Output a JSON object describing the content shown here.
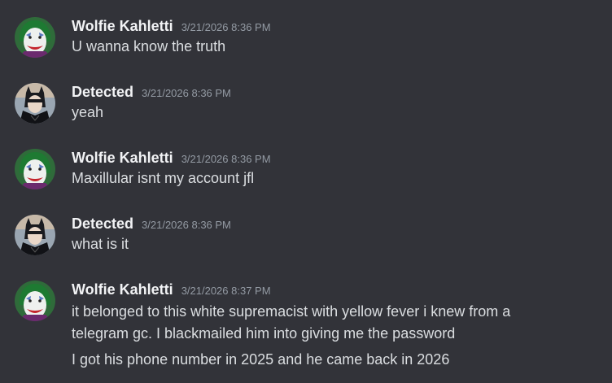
{
  "messages": [
    {
      "author": "Wolfie Kahletti",
      "avatar": "joker-avatar",
      "timestamp": "3/21/2026 8:36 PM",
      "lines": [
        "U wanna know the truth"
      ]
    },
    {
      "author": "Detected",
      "avatar": "dark-knight-avatar",
      "timestamp": "3/21/2026 8:36 PM",
      "lines": [
        "yeah"
      ]
    },
    {
      "author": "Wolfie Kahletti",
      "avatar": "joker-avatar",
      "timestamp": "3/21/2026 8:36 PM",
      "lines": [
        "Maxillular isnt my account jfl"
      ]
    },
    {
      "author": "Detected",
      "avatar": "dark-knight-avatar",
      "timestamp": "3/21/2026 8:36 PM",
      "lines": [
        "what is it"
      ]
    },
    {
      "author": "Wolfie Kahletti",
      "avatar": "joker-avatar",
      "timestamp": "3/21/2026 8:37 PM",
      "lines": [
        "it belonged to this white supremacist with yellow fever i knew from a",
        "telegram gc. I blackmailed him into giving me the password",
        "I got his phone number in 2025 and he came back in 2026"
      ]
    }
  ],
  "colors": {
    "background": "#323339",
    "username": "#f2f3f5",
    "timestamp": "#949ba4",
    "text": "#dbdee1"
  }
}
